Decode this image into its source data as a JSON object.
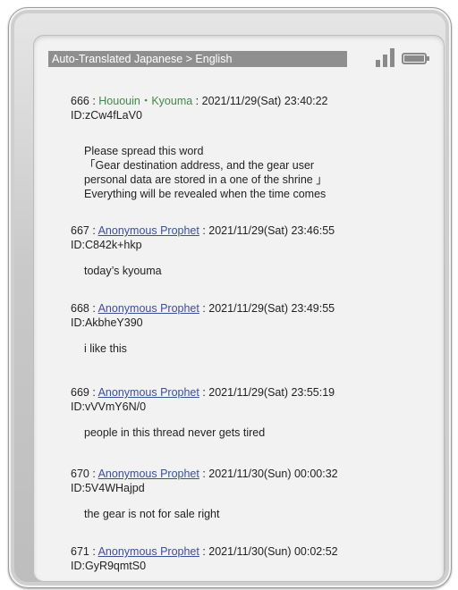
{
  "statusbar": {
    "label": "Auto-Translated  Japanese > English",
    "signal_icon": "signal-bars-icon",
    "battery_icon": "battery-icon"
  },
  "posts": [
    {
      "number": "666",
      "name": "Hououin・Kyouma",
      "date": "2021/11/29(Sat) 23:40:22",
      "id": "ID:zCw4fLaV0",
      "lines": [
        "Please spread this word",
        "「Gear destination address, and the gear user",
        "personal data are stored in a one of the shrine 」",
        "Everything will be revealed when the time comes"
      ]
    },
    {
      "number": "667",
      "name": "Anonymous Prophet",
      "date": "2021/11/29(Sat) 23:46:55",
      "id": "ID:C842k+hkp",
      "lines": [
        "today’s kyouma"
      ]
    },
    {
      "number": "668",
      "name": "Anonymous Prophet",
      "date": "2021/11/29(Sat) 23:49:55",
      "id": "ID:AkbheY390",
      "lines": [
        "i like this"
      ]
    },
    {
      "number": "669",
      "name": "Anonymous Prophet",
      "date": "2021/11/29(Sat) 23:55:19",
      "id": "ID:vVVmY6N/0",
      "lines": [
        "people in this thread never gets tired"
      ]
    },
    {
      "number": "670",
      "name": "Anonymous Prophet",
      "date": "2021/11/30(Sun) 00:00:32",
      "id": "ID:5V4WHajpd",
      "lines": [
        "the gear is not for sale right"
      ]
    },
    {
      "number": "671",
      "name": "Anonymous Prophet",
      "date": "2021/11/30(Sun) 00:02:52",
      "id": "ID:GyR9qmtS0",
      "lines": []
    }
  ]
}
